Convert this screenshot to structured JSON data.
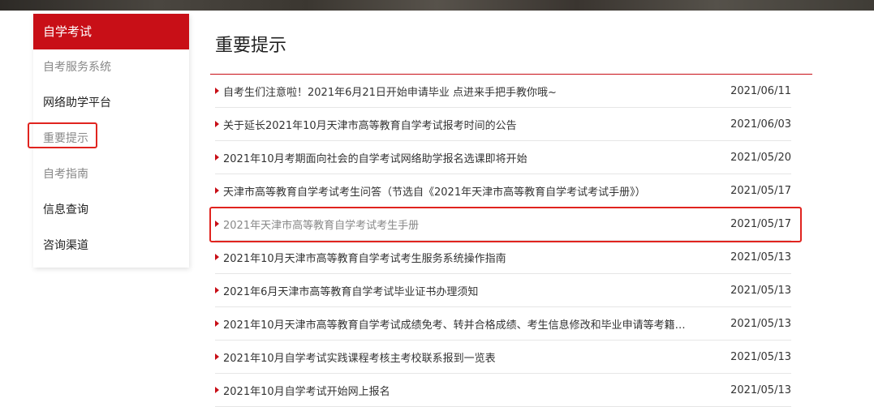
{
  "sidebar": {
    "title": "自学考试",
    "items": [
      {
        "label": "自考服务系统"
      },
      {
        "label": "网络助学平台"
      },
      {
        "label": "重要提示"
      },
      {
        "label": "自考指南"
      },
      {
        "label": "信息查询"
      },
      {
        "label": "咨询渠道"
      }
    ]
  },
  "main": {
    "title": "重要提示",
    "news": [
      {
        "title": "自考生们注意啦！2021年6月21日开始申请毕业 点进来手把手教你哦~",
        "date": "2021/06/11"
      },
      {
        "title": "关于延长2021年10月天津市高等教育自学考试报考时间的公告",
        "date": "2021/06/03"
      },
      {
        "title": "2021年10月考期面向社会的自学考试网络助学报名选课即将开始",
        "date": "2021/05/20"
      },
      {
        "title": "天津市高等教育自学考试考生问答（节选自《2021年天津市高等教育自学考试考试手册》）",
        "date": "2021/05/17"
      },
      {
        "title": "2021年天津市高等教育自学考试考生手册",
        "date": "2021/05/17"
      },
      {
        "title": "2021年10月天津市高等教育自学考试考生服务系统操作指南",
        "date": "2021/05/13"
      },
      {
        "title": "2021年6月天津市高等教育自学考试毕业证书办理须知",
        "date": "2021/05/13"
      },
      {
        "title": "2021年10月天津市高等教育自学考试成绩免考、转并合格成绩、考生信息修改和毕业申请等考籍相...",
        "date": "2021/05/13"
      },
      {
        "title": "2021年10月自学考试实践课程考核主考校联系报到一览表",
        "date": "2021/05/13"
      },
      {
        "title": "2021年10月自学考试开始网上报名",
        "date": "2021/05/13"
      }
    ]
  },
  "colors": {
    "accent": "#c80f17",
    "highlight": "#e0241f"
  }
}
